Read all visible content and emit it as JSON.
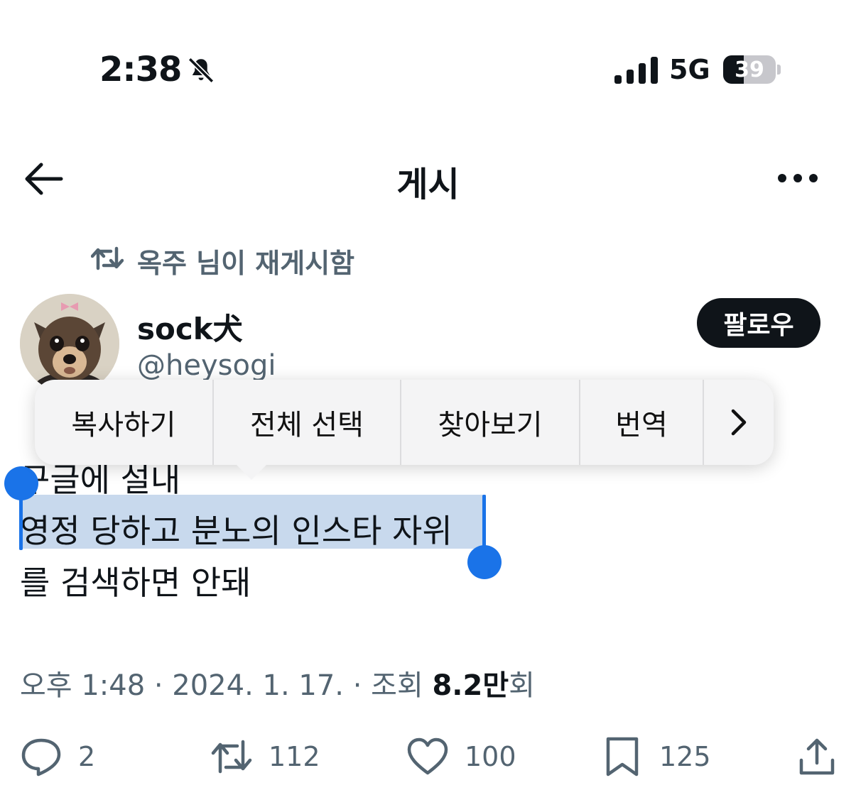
{
  "status_bar": {
    "time": "2:38",
    "network": "5G",
    "battery": "39",
    "battery_level": 0.39
  },
  "nav": {
    "title": "게시"
  },
  "repost": {
    "text": "옥주 님이 재게시함"
  },
  "author": {
    "display_name": "sock犬",
    "handle": "@heysogi",
    "follow_label": "팔로우"
  },
  "tweet": {
    "lines": [
      "구글에 설내",
      "영정 당하고 분노의 인스타 자위",
      "를 검색하면 안돼"
    ]
  },
  "edit_menu": {
    "items": [
      "복사하기",
      "전체 선택",
      "찾아보기",
      "번역"
    ]
  },
  "meta": {
    "prefix": "오후 1:48 · 2024. 1. 17. · 조회 ",
    "views": "8.2만",
    "suffix": "회"
  },
  "actions": {
    "replies": "2",
    "reposts": "112",
    "likes": "100",
    "bookmarks": "125"
  },
  "colors": {
    "accent": "#1a73e8",
    "text": "#0f1419",
    "secondary": "#536471",
    "selection": "#c8d9ed"
  }
}
